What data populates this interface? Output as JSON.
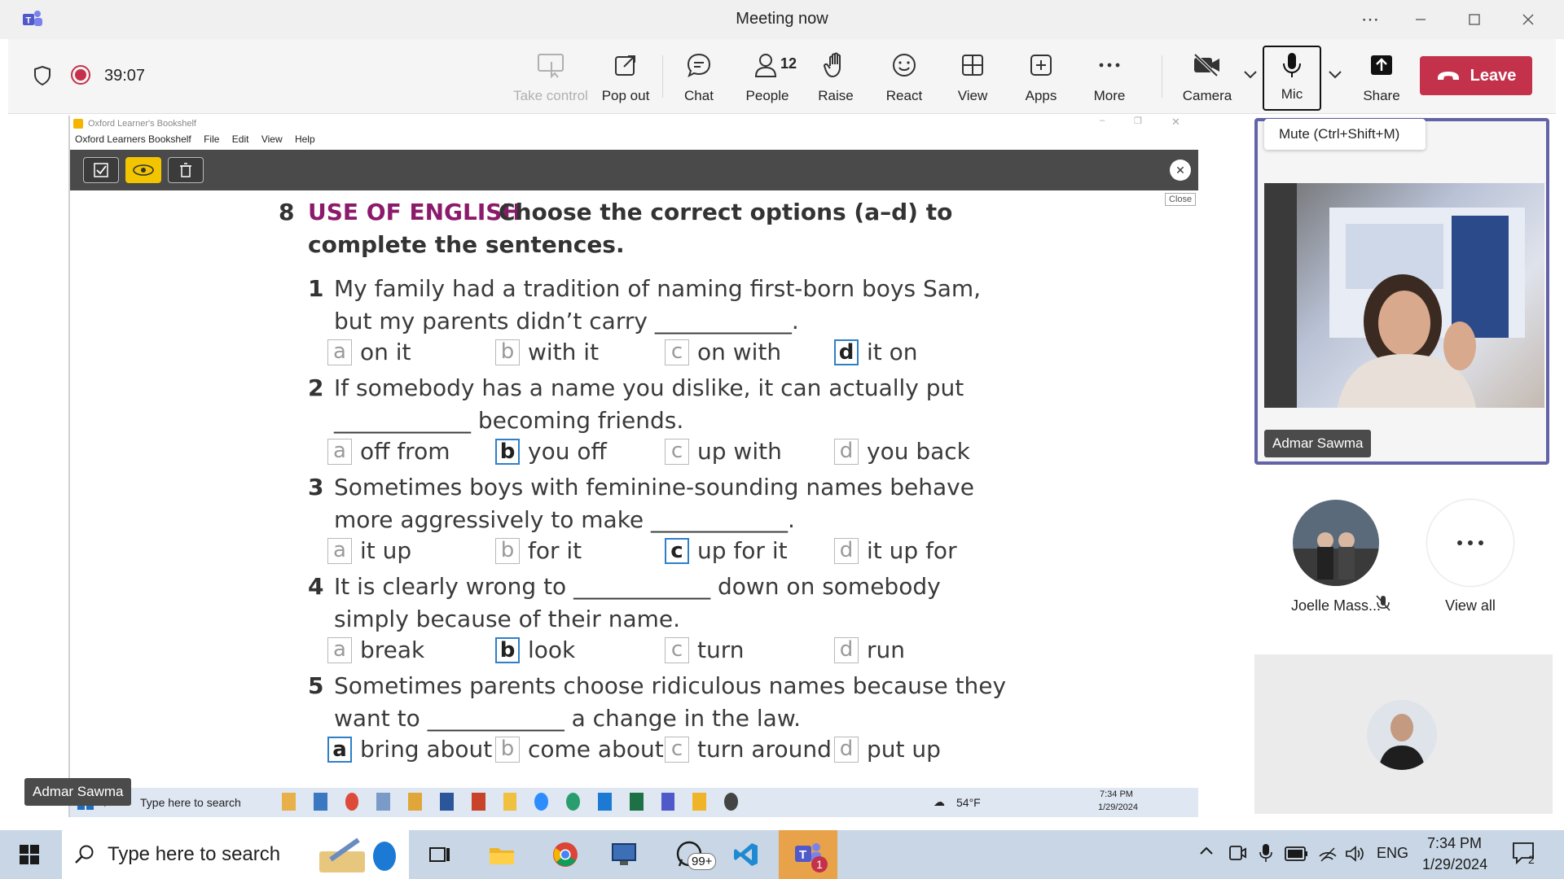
{
  "window": {
    "title": "Meeting now",
    "more_label": "⋯"
  },
  "toolbar": {
    "timer": "39:07",
    "take_control": "Take control",
    "pop_out": "Pop out",
    "chat": "Chat",
    "people": "People",
    "people_count": "12",
    "raise": "Raise",
    "react": "React",
    "view": "View",
    "apps": "Apps",
    "more": "More",
    "camera": "Camera",
    "mic": "Mic",
    "share": "Share",
    "leave": "Leave",
    "mic_tooltip": "Mute (Ctrl+Shift+M)"
  },
  "shared_screen": {
    "app_title": "Oxford Learner's Bookshelf",
    "menu": [
      "Oxford Learners Bookshelf",
      "File",
      "Edit",
      "View",
      "Help"
    ],
    "close_tooltip": "Close",
    "presenter_tag": "Admar Sawma",
    "exercise": {
      "number": "8",
      "label": "USE OF ENGLISH",
      "instruction_line1": "Choose the correct options (a–d) to",
      "instruction_line2": "complete the sentences.",
      "questions": [
        {
          "num": "1",
          "line1": "My family had a tradition of naming first-born boys Sam,",
          "line2": "but my parents didn’t carry ____________.",
          "options": [
            {
              "letter": "a",
              "text": "on it",
              "selected": false
            },
            {
              "letter": "b",
              "text": "with it",
              "selected": false
            },
            {
              "letter": "c",
              "text": "on with",
              "selected": false
            },
            {
              "letter": "d",
              "text": "it on",
              "selected": true
            }
          ]
        },
        {
          "num": "2",
          "line1": "If somebody has a name you dislike, it can actually put",
          "line2": "____________ becoming friends.",
          "options": [
            {
              "letter": "a",
              "text": "off from",
              "selected": false
            },
            {
              "letter": "b",
              "text": "you off",
              "selected": true
            },
            {
              "letter": "c",
              "text": "up with",
              "selected": false
            },
            {
              "letter": "d",
              "text": "you back",
              "selected": false
            }
          ]
        },
        {
          "num": "3",
          "line1": "Sometimes boys with feminine-sounding names behave",
          "line2": "more aggressively to make ____________.",
          "options": [
            {
              "letter": "a",
              "text": "it up",
              "selected": false
            },
            {
              "letter": "b",
              "text": "for it",
              "selected": false
            },
            {
              "letter": "c",
              "text": "up for it",
              "selected": true
            },
            {
              "letter": "d",
              "text": "it up for",
              "selected": false
            }
          ]
        },
        {
          "num": "4",
          "line1": "It is clearly wrong to ____________ down on somebody",
          "line2": "simply because of their name.",
          "options": [
            {
              "letter": "a",
              "text": "break",
              "selected": false
            },
            {
              "letter": "b",
              "text": "look",
              "selected": true
            },
            {
              "letter": "c",
              "text": "turn",
              "selected": false
            },
            {
              "letter": "d",
              "text": "run",
              "selected": false
            }
          ]
        },
        {
          "num": "5",
          "line1": "Sometimes parents choose ridiculous names because they",
          "line2": "want to ____________ a change in the law.",
          "options": [
            {
              "letter": "a",
              "text": "bring about",
              "selected": true
            },
            {
              "letter": "b",
              "text": "come about",
              "selected": false
            },
            {
              "letter": "c",
              "text": "turn around",
              "selected": false
            },
            {
              "letter": "d",
              "text": "put up",
              "selected": false
            }
          ]
        }
      ]
    },
    "taskbar": {
      "search": "Type here to search",
      "weather": "54°F",
      "time": "7:34 PM",
      "date": "1/29/2024"
    }
  },
  "participants": {
    "main_name": "Admar Sawma",
    "second_name": "Joelle Mass...",
    "view_all": "View all"
  },
  "taskbar": {
    "search_placeholder": "Type here to search",
    "whatsapp_badge": "99+",
    "teams_badge": "1",
    "language": "ENG",
    "time": "7:34 PM",
    "date": "1/29/2024",
    "notifications": "2"
  },
  "colors": {
    "leave": "#c4314b",
    "accent": "#6264a7",
    "exercise_label": "#8b1a6b",
    "selected_box": "#2f7fc7"
  }
}
